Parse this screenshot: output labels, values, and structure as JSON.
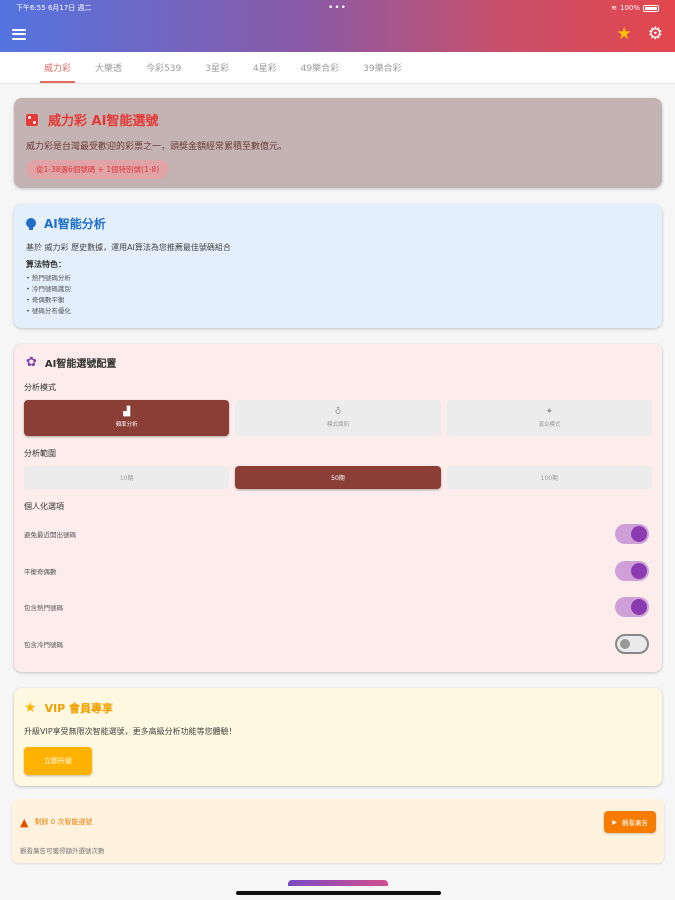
{
  "status_bar": {
    "time_date": "下午6:55   6月17日 週二",
    "dots": "•••",
    "battery": "100%"
  },
  "tabs": [
    "威力彩",
    "大樂透",
    "今彩539",
    "3星彩",
    "4星彩",
    "49樂合彩",
    "39樂合彩"
  ],
  "intro": {
    "title": "威力彩 AI智能選號",
    "desc": "威力彩是台灣最受歡迎的彩票之一，頭獎金額經常累積至數億元。",
    "rule": "從1-38選6個號碼 + 1個特別號(1-8)"
  },
  "analysis": {
    "title": "AI智能分析",
    "desc": "基於 威力彩 歷史數據，運用AI算法為您推薦最佳號碼組合",
    "features_label": "算法特色：",
    "features": [
      "• 熱門號碼分析",
      "• 冷門號碼識別",
      "• 奇偶數平衡",
      "• 號碼分布優化"
    ]
  },
  "config": {
    "title": "AI智能選號配置",
    "mode_label": "分析模式",
    "modes": [
      {
        "label": "頻率分析",
        "icon": "bar-chart-icon",
        "active": true
      },
      {
        "label": "模式識別",
        "icon": "lightbulb-icon",
        "active": false
      },
      {
        "label": "混合模式",
        "icon": "sparkle-icon",
        "active": false
      }
    ],
    "range_label": "分析範圍",
    "ranges": [
      {
        "label": "10期",
        "active": false
      },
      {
        "label": "50期",
        "active": true
      },
      {
        "label": "100期",
        "active": false
      }
    ],
    "personal_label": "個人化選項",
    "options": [
      {
        "label": "避免最近開出號碼",
        "on": true
      },
      {
        "label": "平衡奇偶數",
        "on": true
      },
      {
        "label": "包含熱門號碼",
        "on": true
      },
      {
        "label": "包含冷門號碼",
        "on": false
      }
    ]
  },
  "vip": {
    "title": "VIP 會員專享",
    "desc": "升級VIP享受無限次智能選號，更多高級分析功能等您體驗！",
    "button": "立即升級"
  },
  "quota": {
    "remaining": "剩餘 0 次智能選號",
    "ad_button": "觀看廣告",
    "note": "觀看廣告可獲得額外選號次數"
  },
  "colors": {
    "accent": "#8b3e36",
    "toggle_on": "#8a3bb0",
    "vip": "#ffb300",
    "tab_active": "#e06a60"
  }
}
